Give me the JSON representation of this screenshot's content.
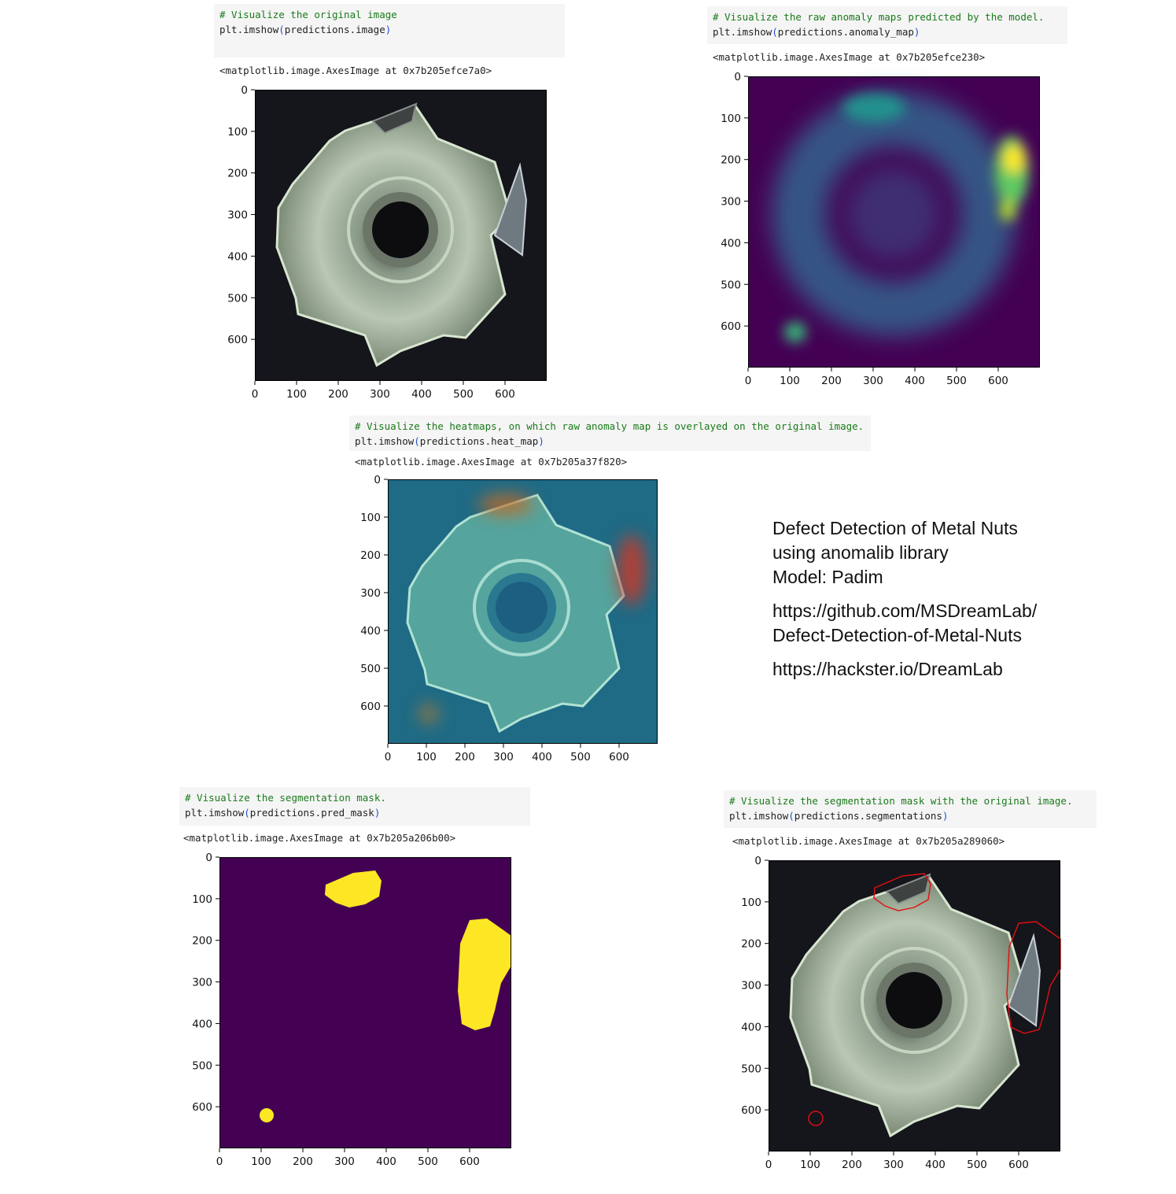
{
  "cells": [
    {
      "comment": "# Visualize the original image",
      "code_fn": "plt.imshow",
      "code_arg": "predictions.image",
      "output": "<matplotlib.image.AxesImage at 0x7b205efce7a0>"
    },
    {
      "comment": "# Visualize the raw anomaly maps predicted by the model.",
      "code_fn": "plt.imshow",
      "code_arg": "predictions.anomaly_map",
      "output": "<matplotlib.image.AxesImage at 0x7b205efce230>"
    },
    {
      "comment": "# Visualize the heatmaps, on which raw anomaly map is overlayed on the original image.",
      "code_fn": "plt.imshow",
      "code_arg": "predictions.heat_map",
      "output": "<matplotlib.image.AxesImage at 0x7b205a37f820>"
    },
    {
      "comment": "# Visualize the segmentation mask.",
      "code_fn": "plt.imshow",
      "code_arg": "predictions.pred_mask",
      "output": "<matplotlib.image.AxesImage at 0x7b205a206b00>"
    },
    {
      "comment": "# Visualize the segmentation mask with the original image.",
      "code_fn": "plt.imshow",
      "code_arg": "predictions.segmentations",
      "output": "<matplotlib.image.AxesImage at 0x7b205a289060>"
    }
  ],
  "axis": {
    "x_ticks": [
      "0",
      "100",
      "200",
      "300",
      "400",
      "500",
      "600"
    ],
    "y_ticks": [
      "0",
      "100",
      "200",
      "300",
      "400",
      "500",
      "600"
    ],
    "extent": 700
  },
  "info": {
    "title_line1": "Defect Detection of Metal Nuts",
    "title_line2": "using anomalib library",
    "model": "Model: Padim",
    "link1_line1": "https://github.com/MSDreamLab/",
    "link1_line2": "Defect-Detection-of-Metal-Nuts",
    "link2": "https://hackster.io/DreamLab"
  },
  "colors": {
    "viridis_dark": "#440154",
    "viridis_yellow": "#fde725",
    "contour_red": "#e01010",
    "background_dark": "#15151c"
  }
}
